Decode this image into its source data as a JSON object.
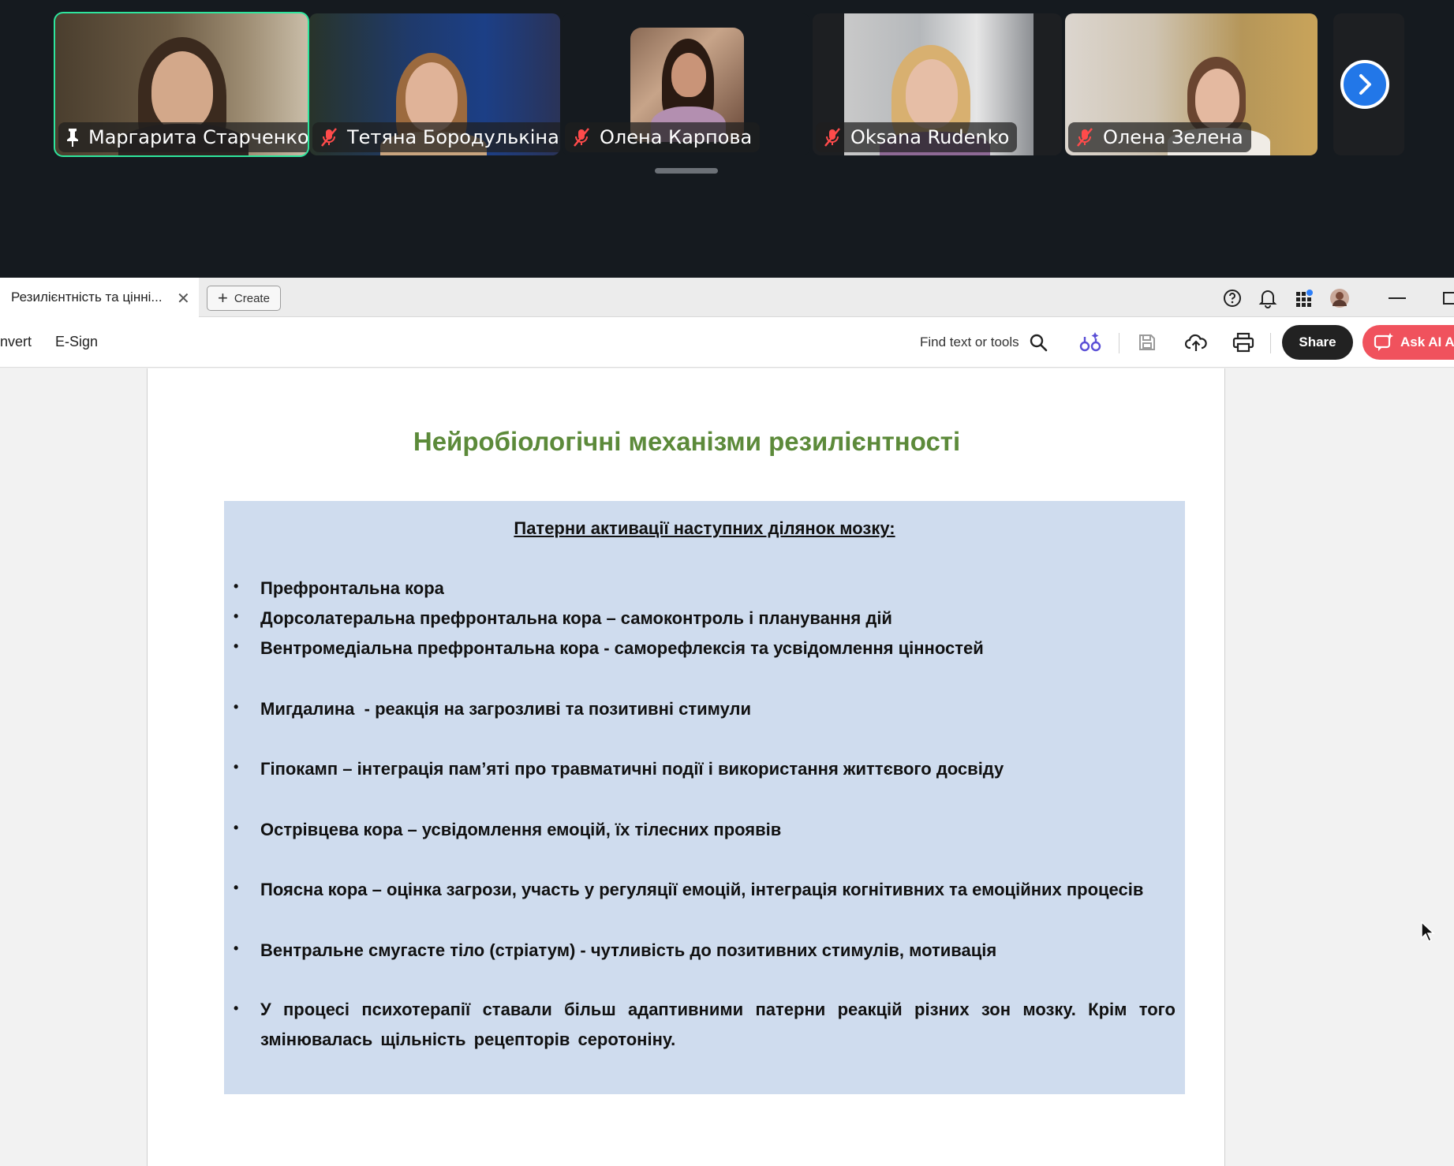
{
  "participants": [
    {
      "name": "Маргарита Старченко",
      "status_icon": "pin-icon",
      "active": true
    },
    {
      "name": "Тетяна Бородулькіна",
      "status_icon": "mic-muted-icon",
      "active": false
    },
    {
      "name": "Олена Карпова",
      "status_icon": "mic-muted-icon",
      "active": false
    },
    {
      "name": "Oksana Rudenko",
      "status_icon": "mic-muted-icon",
      "active": false
    },
    {
      "name": "Олена Зелена",
      "status_icon": "mic-muted-icon",
      "active": false
    }
  ],
  "tabbar": {
    "doc_tab_title": "Резилієнтність та цінні...",
    "close_glyph": "✕",
    "create_label": "Create"
  },
  "toolbar": {
    "menu": [
      "nvert",
      "E-Sign"
    ],
    "find_label": "Find text or tools",
    "share_label": "Share",
    "askai_label": "Ask AI A"
  },
  "slide": {
    "title": "Нейробіологічні механізми резилієнтності",
    "box_heading": "Патерни активації наступних ділянок мозку:",
    "bullet_glyph": "•",
    "bullets": [
      "Префронтальна кора",
      "Дорсолатеральна префронтальна кора – самоконтроль і планування дій",
      "Вентромедіальна префронтальна кора - саморефлексія та усвідомлення цінностей",
      "Мигдалина  - реакція на загрозливі та позитивні стимули",
      "Гіпокамп – інтеграція пам’яті про травматичні події і використання життєвого досвіду",
      "Острівцева кора – усвідомлення емоцій, їх тілесних проявів",
      "Поясна кора – оцінка загрози, участь у регуляції емоцій, інтеграція когнітивних та емоційних процесів",
      "Вентральне смугасте тіло (стріатум) - чутливість до позитивних стимулів, мотивація",
      "У процесі психотерапії ставали більш адаптивними патерни реакцій різних зон мозку.   Крім того змінювалась щільність рецепторів серотоніну."
    ]
  },
  "colors": {
    "active_speaker": "#2ee59d",
    "title_green": "#5c8a3a",
    "box_blue": "#cfdcee",
    "askai_red": "#f0525d",
    "next_blue": "#2277e8"
  }
}
